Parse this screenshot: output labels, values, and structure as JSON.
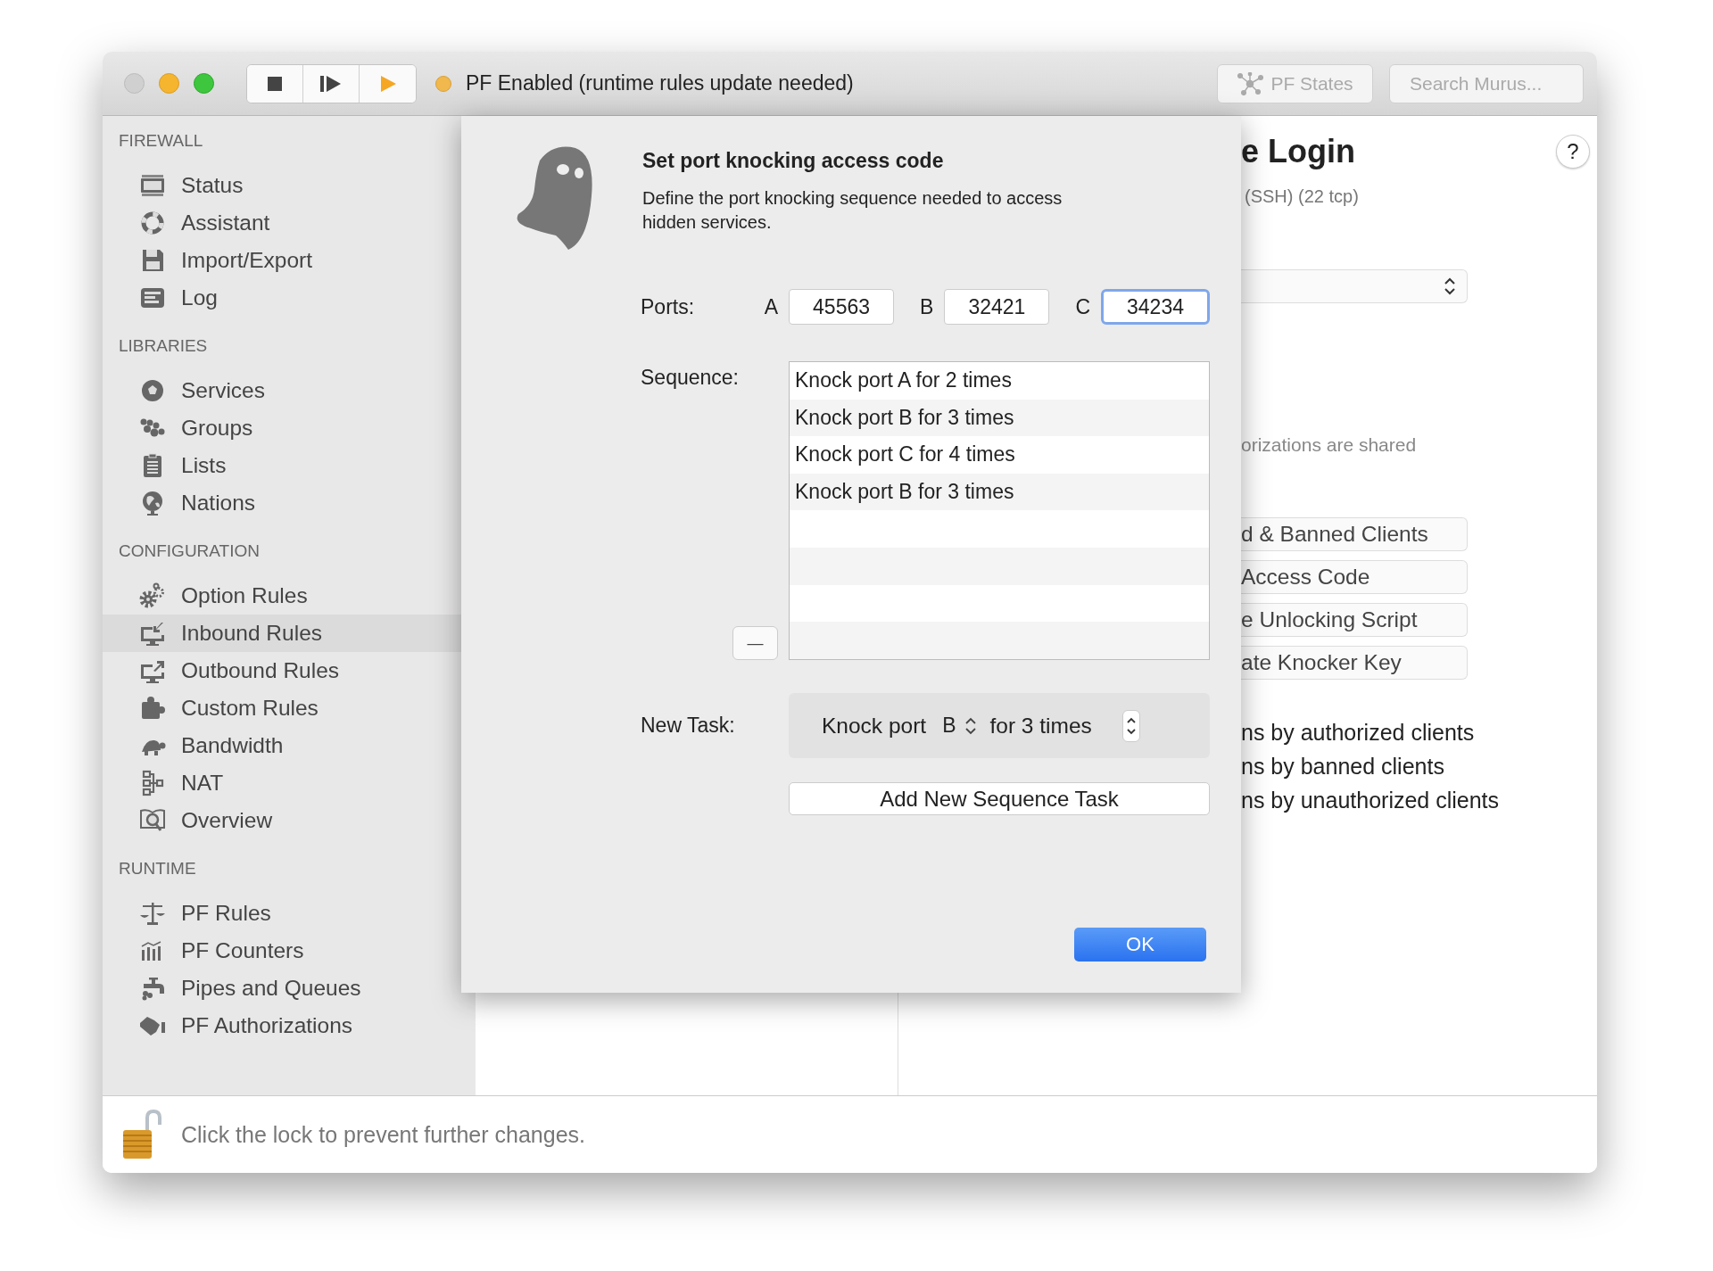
{
  "toolbar": {
    "status": "PF Enabled (runtime rules update needed)",
    "states_button": "PF States",
    "search": {
      "placeholder": "Search Murus..."
    }
  },
  "sidebar": {
    "sections": [
      {
        "title": "FIREWALL",
        "items": [
          {
            "label": "Status",
            "selected": false
          },
          {
            "label": "Assistant",
            "selected": false
          },
          {
            "label": "Import/Export",
            "selected": false
          },
          {
            "label": "Log",
            "selected": false
          }
        ]
      },
      {
        "title": "LIBRARIES",
        "items": [
          {
            "label": "Services",
            "selected": false
          },
          {
            "label": "Groups",
            "selected": false
          },
          {
            "label": "Lists",
            "selected": false
          },
          {
            "label": "Nations",
            "selected": false
          }
        ]
      },
      {
        "title": "CONFIGURATION",
        "items": [
          {
            "label": "Option Rules",
            "selected": false
          },
          {
            "label": "Inbound Rules",
            "selected": true
          },
          {
            "label": "Outbound Rules",
            "selected": false
          },
          {
            "label": "Custom Rules",
            "selected": false
          },
          {
            "label": "Bandwidth",
            "selected": false
          },
          {
            "label": "NAT",
            "selected": false
          },
          {
            "label": "Overview",
            "selected": false
          }
        ]
      },
      {
        "title": "RUNTIME",
        "items": [
          {
            "label": "PF Rules",
            "selected": false
          },
          {
            "label": "PF Counters",
            "selected": false
          },
          {
            "label": "Pipes and Queues",
            "selected": false
          },
          {
            "label": "PF Authorizations",
            "selected": false
          }
        ]
      }
    ]
  },
  "main": {
    "title": "e Login",
    "subtitle": "(SSH) (22 tcp)",
    "help": "?",
    "note": "orizations are shared",
    "buttons": [
      "d & Banned Clients",
      "Access Code",
      "e Unlocking Script",
      "ate Knocker Key"
    ],
    "lines": [
      "ns by authorized clients",
      "ns by banned clients",
      "ns by unauthorized clients"
    ]
  },
  "dialog": {
    "title": "Set port knocking access code",
    "description": "Define the port knocking sequence needed to access hidden services.",
    "ports_label": "Ports:",
    "ports": [
      {
        "letter": "A",
        "value": "45563",
        "focused": false
      },
      {
        "letter": "B",
        "value": "32421",
        "focused": false
      },
      {
        "letter": "C",
        "value": "34234",
        "focused": true
      }
    ],
    "sequence_label": "Sequence:",
    "sequence": [
      "Knock port A for 2 times",
      "Knock port B for 3 times",
      "Knock port C for 4 times",
      "Knock port B for 3 times"
    ],
    "remove_button": "—",
    "new_task": {
      "label": "New Task:",
      "prefix": "Knock port",
      "port": "B",
      "suffix": "for 3 times"
    },
    "add_button": "Add New Sequence Task",
    "ok_button": "OK"
  },
  "footer": {
    "text": "Click the lock to prevent further changes."
  }
}
